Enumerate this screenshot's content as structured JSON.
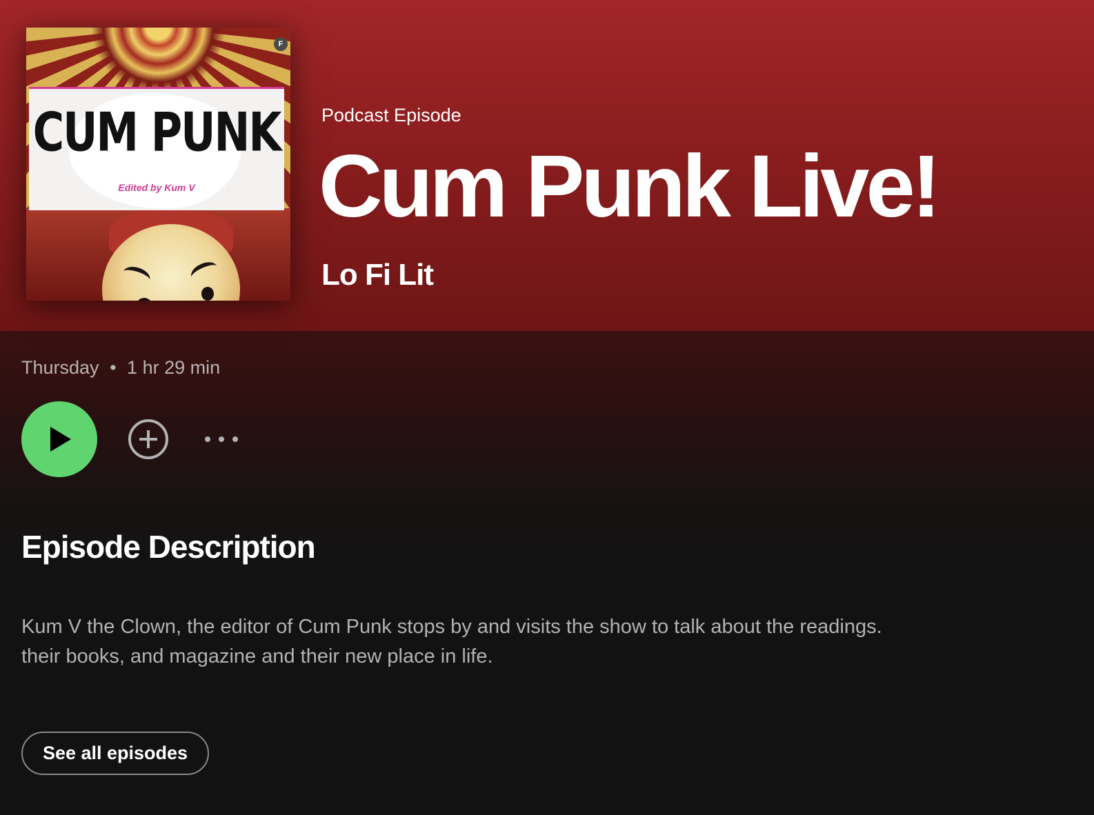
{
  "episode": {
    "type_label": "Podcast Episode",
    "title": "Cum Punk Live!",
    "show_name": "Lo Fi Lit",
    "date": "Thursday",
    "separator": "•",
    "duration": "1 hr 29 min"
  },
  "cover": {
    "title": "CUM PUNK",
    "subtitle": "Edited by Kum V",
    "badge": "F"
  },
  "actions": {
    "play_icon": "play-icon",
    "add_icon": "plus-circle-icon",
    "more_icon": "more-horizontal-icon"
  },
  "description": {
    "heading": "Episode Description",
    "text": "Kum V the Clown, the editor of Cum Punk stops by and visits the show to talk about the readings. their books, and magazine and their new place in life."
  },
  "footer": {
    "see_all_label": "See all episodes"
  },
  "colors": {
    "hero": "#a22628",
    "background": "#121212",
    "play_button": "#5fd46f",
    "muted_text": "#b3b3b3"
  }
}
